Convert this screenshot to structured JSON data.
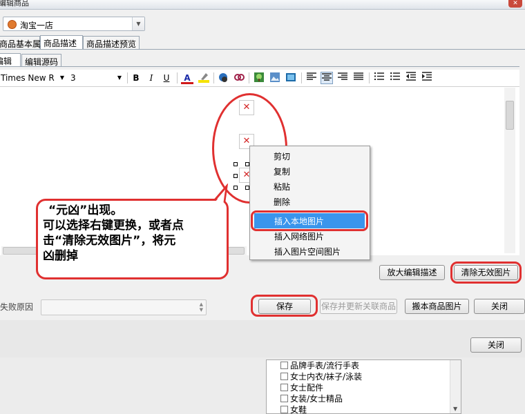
{
  "window": {
    "title": "编辑商品",
    "close_icon": "✕"
  },
  "shop_select": {
    "value": "淘宝一店"
  },
  "main_tabs": [
    "商品基本属性",
    "商品描述",
    "商品描述预览"
  ],
  "editor_tabs": [
    "编辑",
    "编辑源码"
  ],
  "toolbar": {
    "font": "Times New R",
    "size": "3",
    "bold": "B",
    "italic": "I",
    "underline": "U",
    "font_color": "A"
  },
  "context_menu": {
    "items": [
      "剪切",
      "复制",
      "粘贴",
      "删除",
      "插入本地图片",
      "插入网络图片",
      "插入图片空间图片"
    ],
    "highlighted": "插入本地图片"
  },
  "callout": {
    "line1": "“元凶”出现。",
    "line2": "可以选择右键更换，或者点",
    "line3": "击“清除无效图片”，将元",
    "line4": "凶删掉"
  },
  "editor_buttons": {
    "enlarge": "放大编辑描述",
    "clear_invalid": "清除无效图片"
  },
  "fail_reason_label": "失败原因",
  "actions": {
    "save": "保存",
    "save_update": "保存并更新关联商品",
    "move_images": "搬本商品图片",
    "close": "关闭"
  },
  "outer_close": "关闭",
  "categories": [
    "品牌手表/流行手表",
    "女士内衣/袜子/泳装",
    "女士配件",
    "女装/女士精品",
    "女鞋"
  ],
  "colors": {
    "highlight": "#3a95ec",
    "annotation_red": "#e03030"
  }
}
